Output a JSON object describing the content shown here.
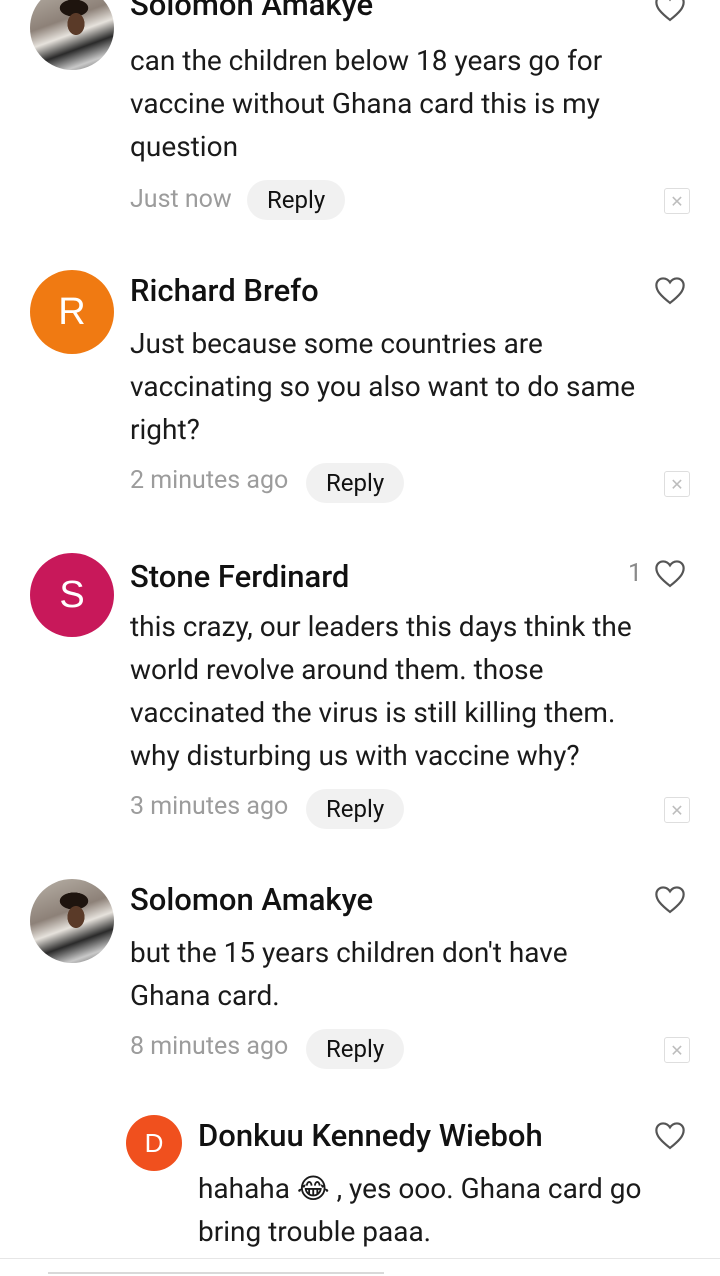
{
  "comments": [
    {
      "author": "Solomon Amakye",
      "avatar_type": "photo",
      "text": "can the children below 18 years go for vaccine without Ghana card this is my question",
      "time": "Just now",
      "reply_label": "Reply",
      "likes": ""
    },
    {
      "author": "Richard Brefo",
      "avatar_letter": "R",
      "avatar_color": "#f07a12",
      "text": "Just because some countries are vaccinating so you also want to do same right?",
      "time": "2 minutes ago",
      "reply_label": "Reply",
      "likes": ""
    },
    {
      "author": "Stone Ferdinard",
      "avatar_letter": "S",
      "avatar_color": "#c8185a",
      "text": "this crazy, our leaders this days think the world revolve around them. those vaccinated the virus is still killing them. why disturbing us with vaccine why?",
      "time": "3 minutes ago",
      "reply_label": "Reply",
      "likes": "1"
    },
    {
      "author": "Solomon Amakye",
      "avatar_type": "photo",
      "text": "but the 15 years children don't have Ghana card.",
      "time": "8 minutes ago",
      "reply_label": "Reply",
      "likes": ""
    },
    {
      "author": "Donkuu Kennedy Wieboh",
      "avatar_letter": "D",
      "avatar_color": "#f0501e",
      "text": "hahaha 😂 , yes ooo. Ghana card go bring trouble paaa.",
      "likes": ""
    }
  ],
  "icons": {
    "like": "heart-outline-icon",
    "dismiss": "close-icon"
  },
  "colors": {
    "meta_text": "#9c9c9c",
    "reply_bg": "#f1f1f1"
  }
}
